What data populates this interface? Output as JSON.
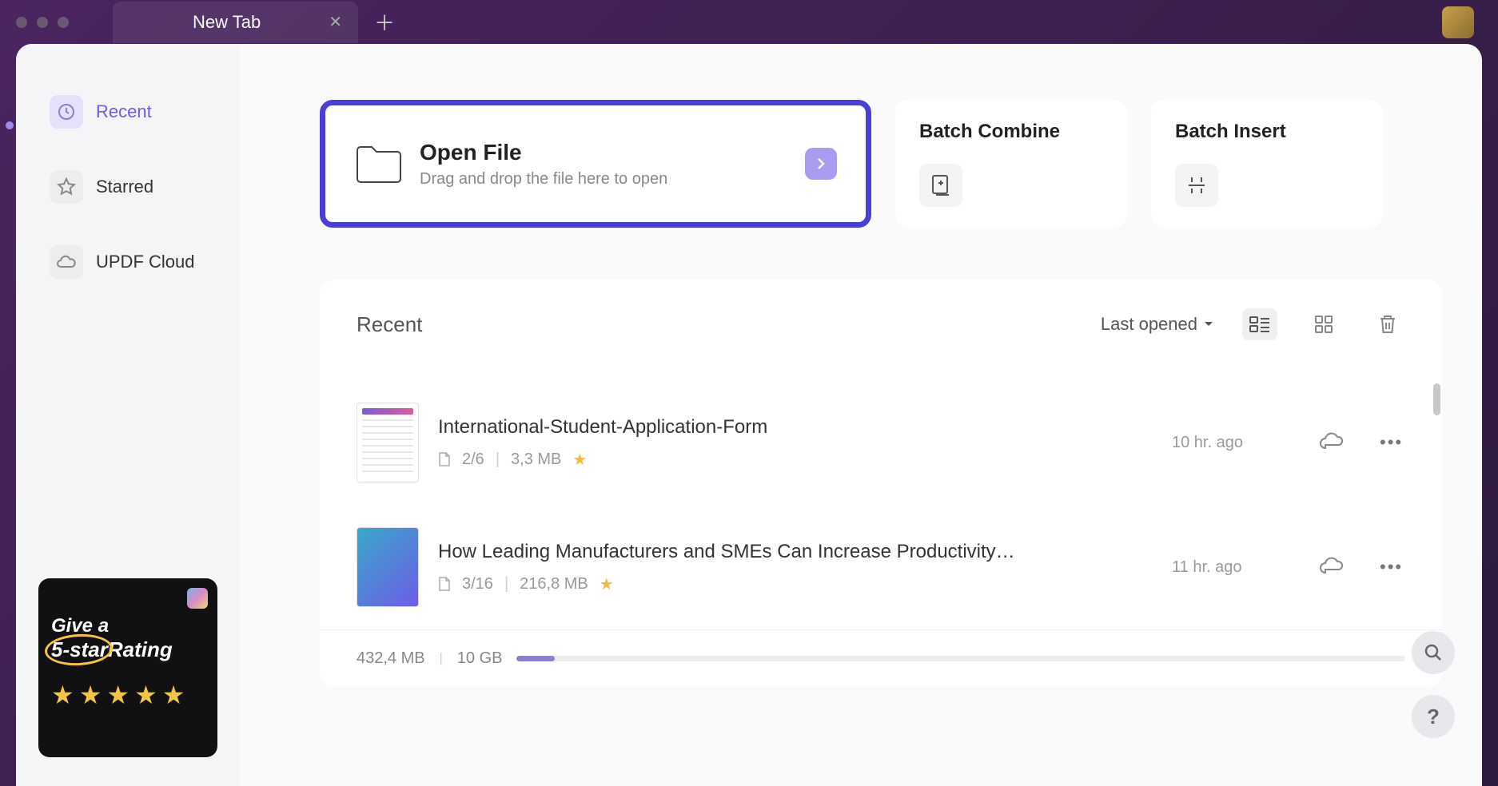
{
  "tab": {
    "title": "New Tab"
  },
  "sidebar": {
    "items": [
      {
        "label": "Recent"
      },
      {
        "label": "Starred"
      },
      {
        "label": "UPDF Cloud"
      }
    ]
  },
  "open_file": {
    "title": "Open File",
    "subtitle": "Drag and drop the file here to open"
  },
  "cards": {
    "batch_combine": "Batch Combine",
    "batch_insert": "Batch Insert"
  },
  "recent": {
    "title": "Recent",
    "sort": "Last opened",
    "files": [
      {
        "name": "International-Student-Application-Form",
        "pages": "2/6",
        "size": "3,3 MB",
        "time": "10 hr. ago",
        "starred": true
      },
      {
        "name": "How Leading Manufacturers and SMEs Can Increase Productivity…",
        "pages": "3/16",
        "size": "216,8 MB",
        "time": "11 hr. ago",
        "starred": true
      }
    ]
  },
  "storage": {
    "used": "432,4 MB",
    "total": "10 GB"
  },
  "rating": {
    "line1": "Give a",
    "line2a": "5-star",
    "line2b": "Rating"
  },
  "help_label": "?"
}
